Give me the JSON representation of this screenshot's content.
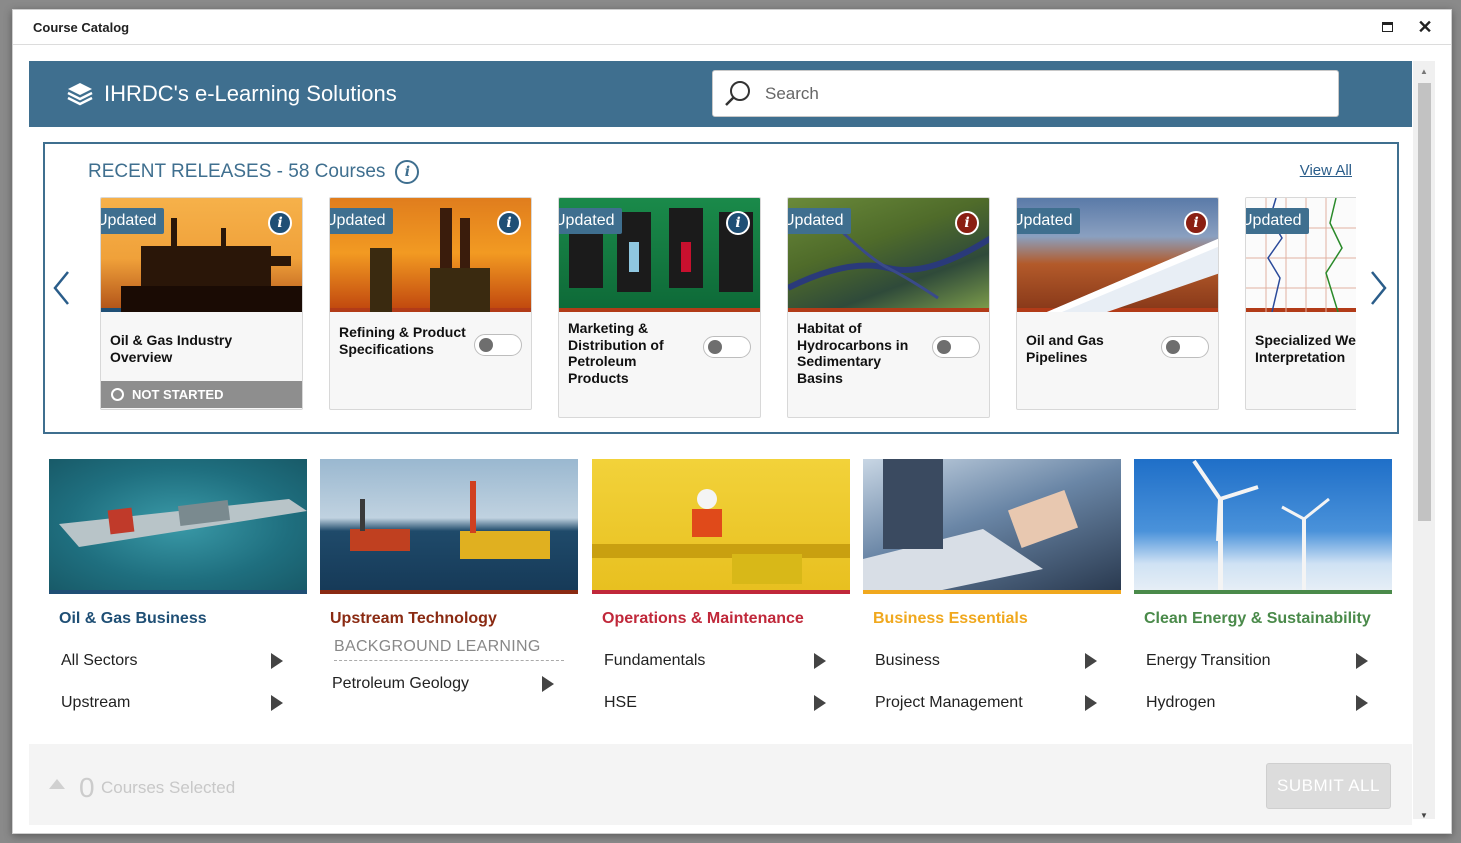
{
  "window": {
    "title": "Course Catalog"
  },
  "header": {
    "brand": "IHRDC's e-Learning Solutions",
    "search_placeholder": "Search"
  },
  "releases": {
    "title": "RECENT RELEASES - 58 Courses",
    "view_all": "View All",
    "cards": [
      {
        "badge": "Updated",
        "title": "Oil & Gas Industry Overview",
        "status": "NOT STARTED",
        "info_color": "#1f4f75"
      },
      {
        "badge": "Updated",
        "title": "Refining & Product Specifications",
        "info_color": "#1f4f75"
      },
      {
        "badge": "Updated",
        "title": "Marketing & Distribution of Petroleum Products",
        "info_color": "#1f4f75"
      },
      {
        "badge": "Updated",
        "title": "Habitat of Hydrocarbons in Sedimentary Basins",
        "info_color": "#8a1f12"
      },
      {
        "badge": "Updated",
        "title": "Oil and Gas Pipelines",
        "info_color": "#8a1f12"
      },
      {
        "badge": "Updated",
        "title": "Specialized Well Log Interpretation"
      }
    ]
  },
  "categories": [
    {
      "title": "Oil & Gas Business",
      "color": "#1f4f75",
      "items": [
        "All Sectors",
        "Upstream"
      ]
    },
    {
      "title": "Upstream Technology",
      "color": "#8a2a12",
      "subheader": "BACKGROUND LEARNING",
      "items": [
        "Petroleum Geology"
      ]
    },
    {
      "title": "Operations & Maintenance",
      "color": "#c0283a",
      "items": [
        "Fundamentals",
        "HSE"
      ]
    },
    {
      "title": "Business Essentials",
      "color": "#f0a81e",
      "items": [
        "Business",
        "Project Management"
      ]
    },
    {
      "title": "Clean Energy & Sustainability",
      "color": "#4a8a4a",
      "items": [
        "Energy Transition",
        "Hydrogen"
      ]
    }
  ],
  "footer": {
    "count": "0",
    "label": "Courses Selected",
    "submit": "SUBMIT ALL"
  }
}
